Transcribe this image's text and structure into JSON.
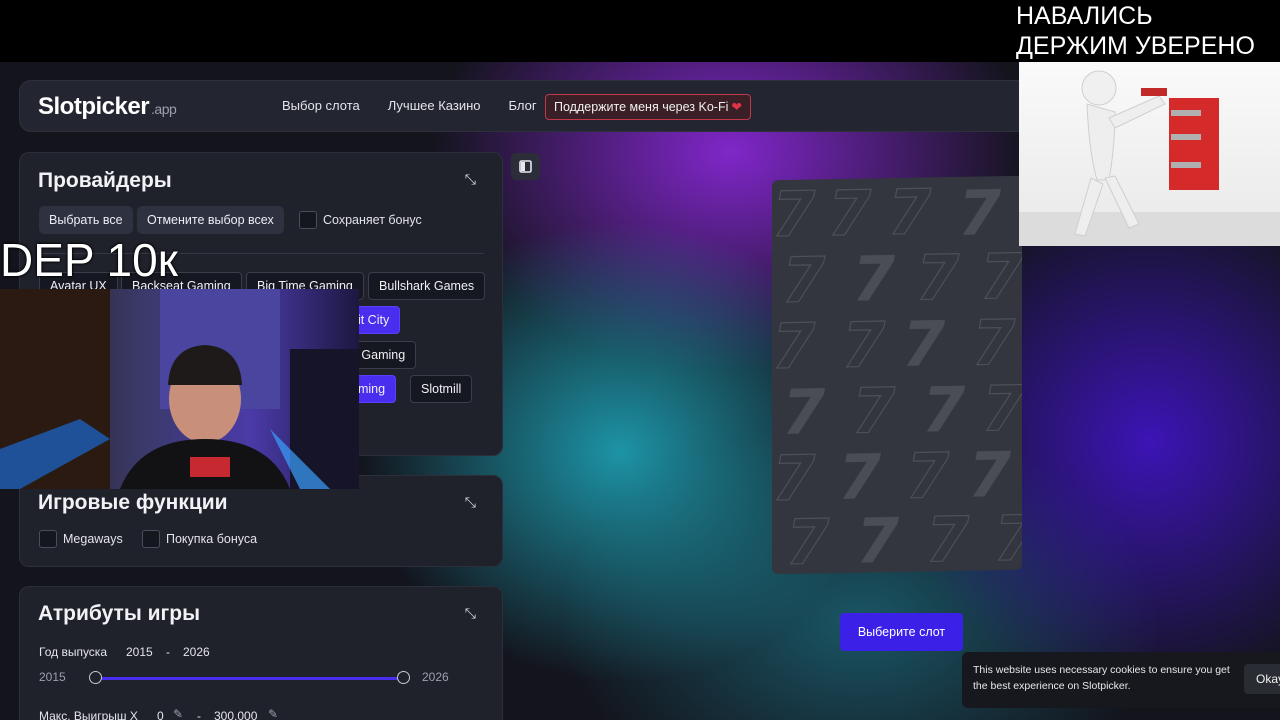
{
  "overlay": {
    "top_text_line1": "НАВАЛИСЬ",
    "top_text_line2": "ДЕРЖИМ УВЕРЕНО",
    "dep_text": "DEP 10к"
  },
  "nav": {
    "logo": "Slotpicker",
    "logo_suffix": ".app",
    "links": [
      "Выбор слота",
      "Лучшее Казино",
      "Блог"
    ],
    "kofi_label": "Поддержите меня через Ko-Fi"
  },
  "providers": {
    "title": "Провайдеры",
    "select_all": "Выбрать все",
    "deselect_all": "Отмените выбор всех",
    "keeps_bonus": "Сохраняет бонус",
    "chips": [
      "Avatar UX",
      "Backseat Gaming",
      "Big Time Gaming",
      "Bullshark Games",
      "nit City",
      "h Gaming",
      "aming",
      "Slotmill"
    ]
  },
  "features": {
    "title": "Игровые функции",
    "megaways": "Megaways",
    "bonus_buy": "Покупка бонуса"
  },
  "attributes": {
    "title": "Атрибуты игры",
    "year_label": "Год выпуска",
    "year_from": "2015",
    "year_sep": "-",
    "year_to": "2026",
    "range_min": "2015",
    "range_max": "2026",
    "maxwin_label": "Макс. Выигрыш Х",
    "maxwin_from": "0",
    "maxwin_sep": "-",
    "maxwin_to": "300,000"
  },
  "slot": {
    "choose_label": "Выберите слот"
  },
  "cookie": {
    "text": "This website uses necessary cookies to ensure you get the best experience on Slotpicker.",
    "button": "Okay"
  },
  "colors": {
    "accent": "#4a2ef0",
    "panel_bg": "#1f222b",
    "kofi_border": "#c23a4a"
  },
  "icons": [
    "collapse-icon",
    "sidebar-toggle-icon",
    "heart-icon",
    "edit-icon"
  ]
}
